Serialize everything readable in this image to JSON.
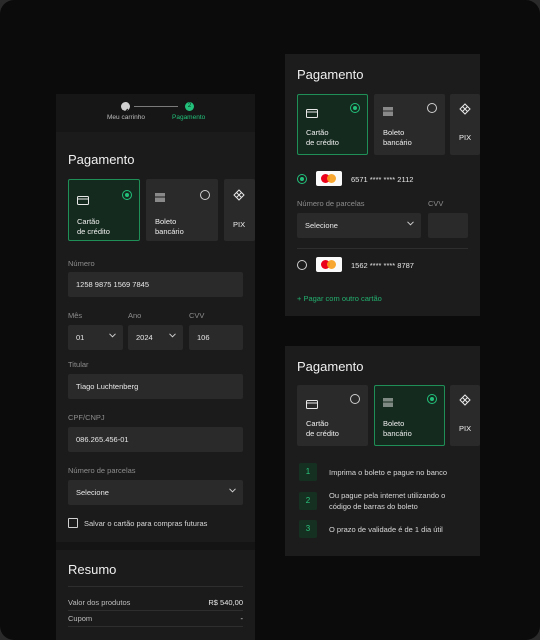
{
  "colors": {
    "accent": "#22c07a",
    "panel": "#1c1c1c",
    "field": "#2a2a2a"
  },
  "stepper": {
    "steps": [
      {
        "label": "Meu carrinho",
        "state": "done"
      },
      {
        "label": "Pagamento",
        "number": "2",
        "state": "active"
      }
    ]
  },
  "left": {
    "title": "Pagamento",
    "methods": {
      "card": "Cartão\nde crédito",
      "boleto": "Boleto\nbancário",
      "pix": "PIX"
    },
    "numero": {
      "label": "Número",
      "value": "1258 9875 1569 7845"
    },
    "mes": {
      "label": "Mês",
      "value": "01"
    },
    "ano": {
      "label": "Ano",
      "value": "2024"
    },
    "cvv": {
      "label": "CVV",
      "value": "106"
    },
    "titular": {
      "label": "Titular",
      "value": "Tiago Luchtenberg"
    },
    "cpf": {
      "label": "CPF/CNPJ",
      "value": "086.265.456-01"
    },
    "parcelas": {
      "label": "Número de parcelas",
      "value": "Selecione"
    },
    "salvar": "Salvar o cartão para compras futuras",
    "resumo": {
      "title": "Resumo",
      "rows": [
        {
          "label": "Valor dos produtos",
          "value": "R$ 540,00"
        },
        {
          "label": "Cupom",
          "value": "-"
        }
      ]
    }
  },
  "topRight": {
    "title": "Pagamento",
    "methods": {
      "card": "Cartão\nde crédito",
      "boleto": "Boleto\nbancário",
      "pix": "PIX"
    },
    "card1": {
      "number": "6571 **** **** 2112"
    },
    "parcelas": {
      "label": "Número de parcelas",
      "value": "Selecione"
    },
    "cvv": {
      "label": "CVV"
    },
    "card2": {
      "number": "1562 **** **** 8787"
    },
    "addCard": "+ Pagar com outro cartão"
  },
  "bottomRight": {
    "title": "Pagamento",
    "methods": {
      "card": "Cartão\nde crédito",
      "boleto": "Boleto\nbancário",
      "pix": "PIX"
    },
    "steps": [
      {
        "n": "1",
        "text": "Imprima o boleto e pague no banco"
      },
      {
        "n": "2",
        "text": "Ou pague pela internet utilizando o\ncódigo de barras do boleto"
      },
      {
        "n": "3",
        "text": "O prazo de validade é de 1 dia útil"
      }
    ]
  }
}
